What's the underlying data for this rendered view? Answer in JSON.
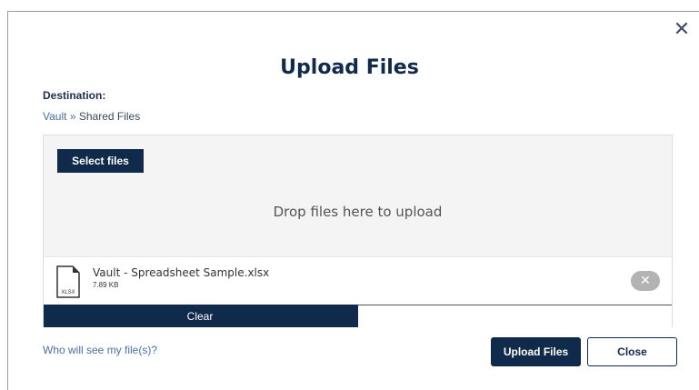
{
  "dialog": {
    "close_icon": "close-icon",
    "title": "Upload Files"
  },
  "destination": {
    "label": "Destination:",
    "breadcrumb": {
      "root": "Vault",
      "separator": "»",
      "current": "Shared Files"
    }
  },
  "dropzone": {
    "select_button": "Select files",
    "hint": "Drop files here to upload",
    "files": [
      {
        "name": "Vault - Spreadsheet Sample.xlsx",
        "size": "7.89 KB",
        "type_label": "XLSX",
        "icon": "file-xlsx-icon",
        "remove_icon": "remove-icon",
        "progress_fraction": 0.5,
        "action_label": "Clear"
      }
    ]
  },
  "footer": {
    "help_link": "Who will see my file(s)?",
    "upload_button": "Upload Files",
    "close_button": "Close"
  },
  "colors": {
    "primary": "#0f2a4a",
    "link": "#4a6fa5",
    "dropzone_bg": "#f4f4f4",
    "remove_badge": "#b3b3b3"
  }
}
